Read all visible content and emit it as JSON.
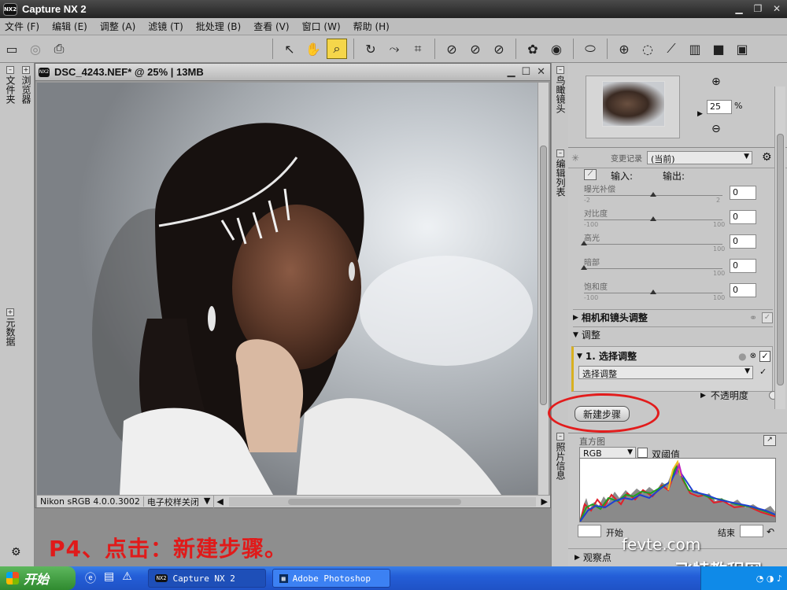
{
  "app": {
    "title": "Capture NX 2",
    "logo_text": "NX2"
  },
  "menu": [
    {
      "label": "文件 (F)"
    },
    {
      "label": "编辑 (E)"
    },
    {
      "label": "调整 (A)"
    },
    {
      "label": "滤镜 (T)"
    },
    {
      "label": "批处理 (B)"
    },
    {
      "label": "查看 (V)"
    },
    {
      "label": "窗口 (W)"
    },
    {
      "label": "帮助 (H)"
    }
  ],
  "left_dock": {
    "tab1": "文件夹",
    "tab2": "浏览器",
    "tab3": "元数据"
  },
  "document": {
    "title": "DSC_4243.NEF* @ 25% | 13MB",
    "color_profile": "Nikon sRGB 4.0.0.3002",
    "soft_proof": "电子校样关闭"
  },
  "right_dock": {
    "tab_birdseye": "鸟瞰镜头",
    "tab_editlist": "编辑列表",
    "tab_photoinfo": "照片信息"
  },
  "birdseye": {
    "zoom_value": "25",
    "zoom_unit": "%"
  },
  "edit_list": {
    "history_label": "变更记录",
    "history_value": "(当前)",
    "input_label": "输入:",
    "output_label": "输出:",
    "sliders": [
      {
        "label": "曝光补偿",
        "min": "-2",
        "max": "2",
        "value": "0",
        "pos": 0.5
      },
      {
        "label": "对比度",
        "min": "-100",
        "max": "100",
        "value": "0",
        "pos": 0.5
      },
      {
        "label": "高光",
        "min": "",
        "max": "100",
        "value": "0",
        "pos": 0.0
      },
      {
        "label": "暗部",
        "min": "",
        "max": "100",
        "value": "0",
        "pos": 0.0
      },
      {
        "label": "饱和度",
        "min": "-100",
        "max": "100",
        "value": "0",
        "pos": 0.5
      }
    ],
    "camera_lens_section": "相机和镜头调整",
    "adjust_section": "调整",
    "step_title": "1. 选择调整",
    "step_dropdown": "选择调整",
    "opacity_label": "不透明度",
    "new_step_button": "新建步骤"
  },
  "photo_info": {
    "section_label": "直方图",
    "channel": "RGB",
    "dual_threshold": "双阈值",
    "start_label": "开始",
    "end_label": "结束",
    "bottom_section": "观察点"
  },
  "caption": "P4、点击：新建步骤。",
  "watermark": {
    "site": "fevte.com",
    "brand": "飞特教程网"
  },
  "taskbar": {
    "start_label": "开始",
    "tasks": [
      {
        "label": "Capture NX 2"
      },
      {
        "label": "Adobe Photoshop"
      }
    ]
  },
  "colors": {
    "highlight": "#e21c1c",
    "accent": "#d8b020",
    "taskbar": "#245ed8"
  }
}
